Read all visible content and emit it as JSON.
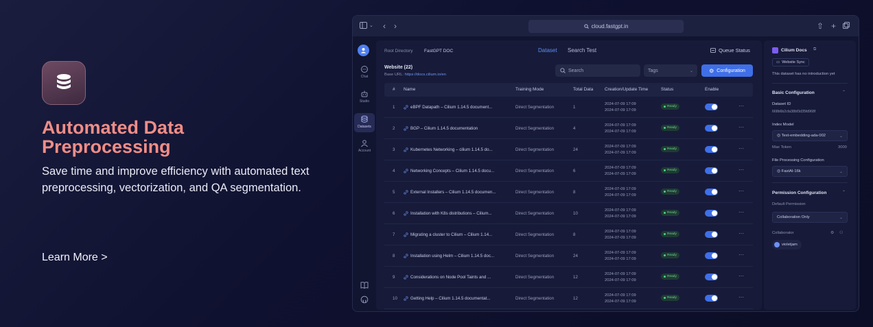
{
  "hero": {
    "icon": "database-icon",
    "title": "Automated Data Preprocessing",
    "description": "Save time and improve efficiency with automated text preprocessing, vectorization, and QA segmentation.",
    "learn_more": "Learn More >"
  },
  "browser": {
    "url": "cloud.fastgpt.in"
  },
  "nav": {
    "items": [
      {
        "label": "Chat",
        "icon": "chat-icon"
      },
      {
        "label": "Studio",
        "icon": "robot-icon"
      },
      {
        "label": "Datasets",
        "icon": "database-icon",
        "active": true
      },
      {
        "label": "Account",
        "icon": "user-icon"
      }
    ]
  },
  "main": {
    "breadcrumb_root": "Root Directory",
    "breadcrumb_current": "FastGPT DOC",
    "tabs": [
      "Dataset",
      "Search Test"
    ],
    "queue_status": "Queue Status",
    "website_title": "Website (22)",
    "base_url_label": "Base URL:",
    "base_url": "https://docs.cilium.io/en",
    "search_placeholder": "Search",
    "tags_label": "Tags",
    "configuration_button": "Configuration",
    "columns": [
      "#",
      "Name",
      "Training Mode",
      "Total Data",
      "Creation/Update Time",
      "Status",
      "Enable"
    ],
    "rows": [
      {
        "idx": "1",
        "name": "eBPF Datapath – Cilium 1.14.5 document...",
        "mode": "Direct Segmentation",
        "total": "1",
        "created": "2024-07-09 17:09",
        "updated": "2024-07-09 17:09",
        "status": "Ready"
      },
      {
        "idx": "2",
        "name": "BGP – Cilium 1.14.5 documentation",
        "mode": "Direct Segmentation",
        "total": "4",
        "created": "2024-07-09 17:09",
        "updated": "2024-07-09 17:09",
        "status": "Ready"
      },
      {
        "idx": "3",
        "name": "Kubernetes Networking – cilium 1.14.5 do...",
        "mode": "Direct Segmentation",
        "total": "24",
        "created": "2024-07-09 17:09",
        "updated": "2024-07-09 17:09",
        "status": "Ready"
      },
      {
        "idx": "4",
        "name": "Networking Concepts – Cilium 1.14.5 docu...",
        "mode": "Direct Segmentation",
        "total": "6",
        "created": "2024-07-09 17:09",
        "updated": "2024-07-09 17:09",
        "status": "Ready"
      },
      {
        "idx": "5",
        "name": "External Installers – Cilium 1.14.5 documen...",
        "mode": "Direct Segmentation",
        "total": "8",
        "created": "2024-07-09 17:09",
        "updated": "2024-07-09 17:09",
        "status": "Ready"
      },
      {
        "idx": "6",
        "name": "Installation with K8s distributions – Cilium...",
        "mode": "Direct Segmentation",
        "total": "10",
        "created": "2024-07-09 17:09",
        "updated": "2024-07-09 17:09",
        "status": "Ready"
      },
      {
        "idx": "7",
        "name": "Migrating a cluster to Cilium – Cilium 1.14...",
        "mode": "Direct Segmentation",
        "total": "8",
        "created": "2024-07-09 17:09",
        "updated": "2024-07-09 17:09",
        "status": "Ready"
      },
      {
        "idx": "8",
        "name": "Installation using Helm – Cilium 1.14.5 doc...",
        "mode": "Direct Segmentation",
        "total": "24",
        "created": "2024-07-09 17:09",
        "updated": "2024-07-09 17:09",
        "status": "Ready"
      },
      {
        "idx": "9",
        "name": "Considerations on Node Pool Taints and ...",
        "mode": "Direct Segmentation",
        "total": "12",
        "created": "2024-07-09 17:09",
        "updated": "2024-07-09 17:09",
        "status": "Ready"
      },
      {
        "idx": "10",
        "name": "Getting Help – Cilium 1.14.5 documentat...",
        "mode": "Direct Segmentation",
        "total": "12",
        "created": "2024-07-09 17:09",
        "updated": "2024-07-09 17:09",
        "status": "Ready"
      }
    ]
  },
  "side": {
    "title": "Cilium Docs",
    "website_sync": "Website Sync",
    "intro": "This dataset has no introduction yet",
    "basic_config": "Basic Configuration",
    "dataset_id_label": "Dataset ID",
    "dataset_id": "668b6b2cfa38bf3d35fd968f",
    "index_model_label": "Index Model",
    "index_model": "Text-embedding-ada-002",
    "max_token_label": "Max Token",
    "max_token": "3000",
    "file_proc_label": "File Processing Configuration",
    "file_proc": "FastAI-16k",
    "perm_config": "Permission Configuration",
    "default_perm_label": "Default Permission",
    "default_perm": "Collaboration Only",
    "collaborator_label": "Collaborator",
    "collaborator": "violetjam"
  },
  "colors": {
    "accent": "#3f6fe8",
    "hero_title": "#f08d86",
    "ready": "#6bd49a"
  }
}
